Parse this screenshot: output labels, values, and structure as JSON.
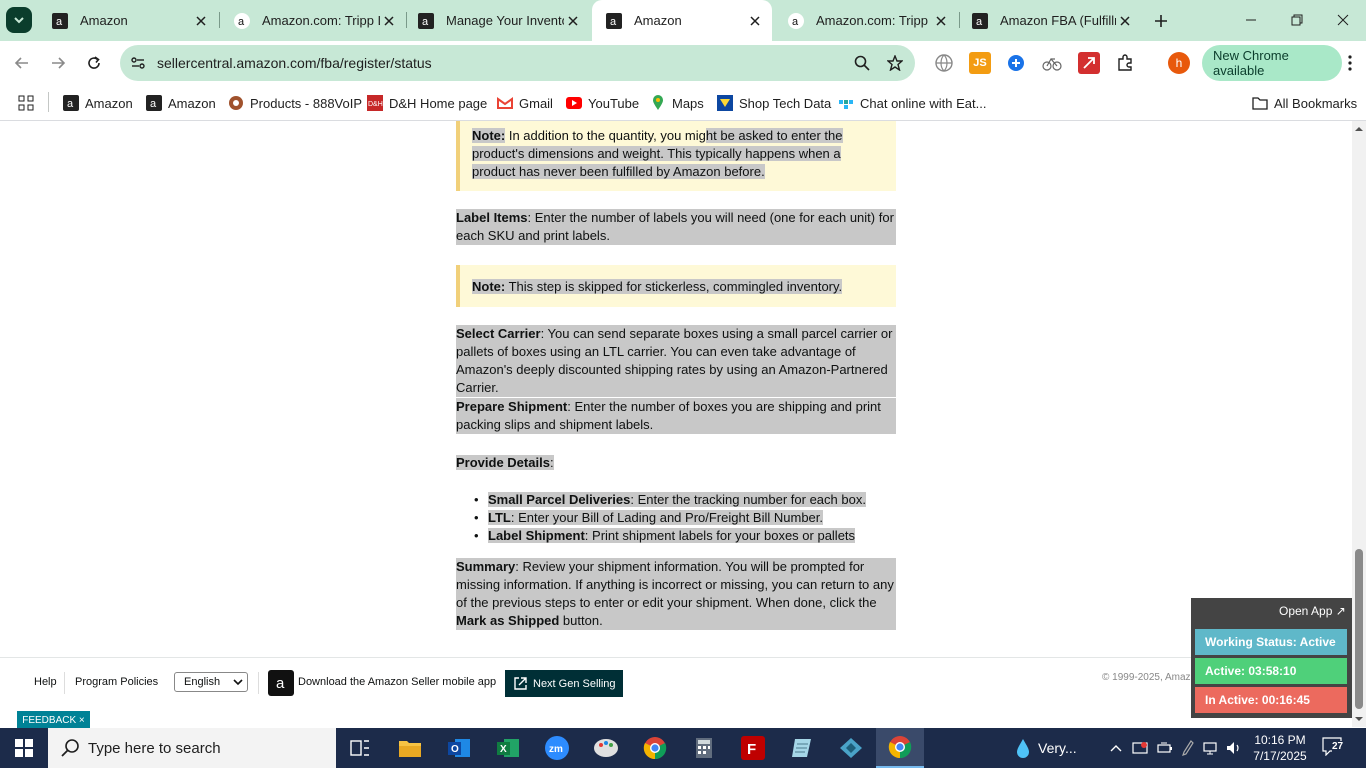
{
  "browser": {
    "tabs": [
      {
        "title": "Amazon",
        "active": false
      },
      {
        "title": "Amazon.com: Tripp Li",
        "active": false
      },
      {
        "title": "Manage Your Invento",
        "active": false
      },
      {
        "title": "Amazon",
        "active": true
      },
      {
        "title": "Amazon.com: Tripp Li",
        "active": false
      },
      {
        "title": "Amazon FBA (Fulfillm",
        "active": false
      }
    ],
    "url": "sellercentral.amazon.com/fba/register/status",
    "new_chrome_label": "New Chrome available",
    "profile_initial": "h",
    "bookmarks": [
      {
        "label": "Amazon"
      },
      {
        "label": "Amazon"
      },
      {
        "label": "Products - 888VoIP"
      },
      {
        "label": "D&H Home page"
      },
      {
        "label": "Gmail"
      },
      {
        "label": "YouTube"
      },
      {
        "label": "Maps"
      },
      {
        "label": "Shop Tech Data"
      },
      {
        "label": "Chat online with Eat..."
      }
    ],
    "all_bookmarks_label": "All Bookmarks"
  },
  "content": {
    "note1_label": "Note:",
    "note1_text_a": " In addition to the quantity, you mig",
    "note1_text_b": "ht be asked to enter the product's dimensions and weight. This typically happens when a product has never been fulfilled by Amazon before.",
    "label_items_title": "Label Items",
    "label_items_text": ": Enter the number of labels you will need (one for each unit) for each SKU and print labels.",
    "note2_label": "Note:",
    "note2_text": " This step is skipped for stickerless, commingled inventory.",
    "select_carrier_title": "Select Carrier",
    "select_carrier_text": ": You can send separate boxes using a small parcel carrier or pallets of boxes using an LTL carrier. You can even take advantage of Amazon's deeply discounted shipping rates by using an Amazon-Partnered Carrier.",
    "prepare_title": "Prepare Shipment",
    "prepare_text": ": Enter the number of boxes you are shipping and print packing slips and shipment labels.",
    "provide_title": "Provide Details",
    "provide_colon": ":",
    "bullets": [
      {
        "title": "Small Parcel Deliveries",
        "text": ": Enter the tracking number for each box."
      },
      {
        "title": "LTL",
        "text": ": Enter your Bill of Lading and Pro/Freight Bill Number."
      },
      {
        "title": "Label Shipment",
        "text": ": Print shipment labels for your boxes or pallets"
      }
    ],
    "summary_title": "Summary",
    "summary_text": ": Review your shipment information. You will be prompted for missing information. If anything is incorrect or missing, you can return to any of the previous steps to enter or edit your shipment. When done, click the ",
    "summary_bold": "Mark as Shipped",
    "summary_end": " button."
  },
  "footer": {
    "help": "Help",
    "program_policies": "Program Policies",
    "language": "English",
    "download_app": "Download the Amazon Seller mobile app",
    "next_gen": "Next Gen Selling",
    "copyright": "© 1999-2025, Amaz",
    "feedback": "FEEDBACK ×"
  },
  "widget": {
    "open_app": "Open App ↗",
    "working_status": "Working Status: Active",
    "active": "Active: 03:58:10",
    "inactive": "In Active: 00:16:45",
    "colors": {
      "status": "#5fb8c9",
      "active": "#4fd07a",
      "inactive": "#ec6a5e"
    }
  },
  "taskbar": {
    "search_placeholder": "Type here to search",
    "weather": "Very...",
    "time": "10:16 PM",
    "date": "7/17/2025",
    "notifications": "27"
  }
}
